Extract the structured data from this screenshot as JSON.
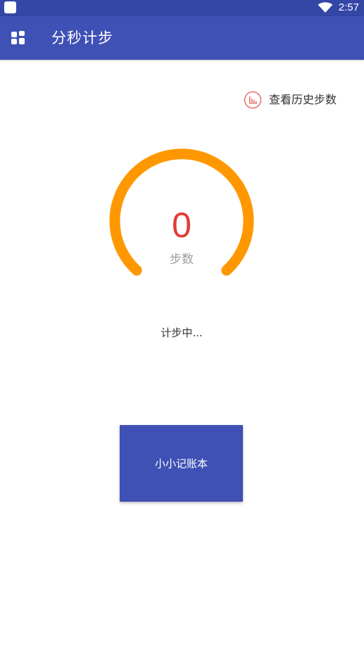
{
  "status_bar": {
    "time": "2:57",
    "icons": [
      "notification-icon",
      "wifi-icon"
    ]
  },
  "app_bar": {
    "title": "分秒计步",
    "menu_icon": "grid-menu-icon"
  },
  "history": {
    "label": "查看历史步数",
    "icon": "bar-chart-icon"
  },
  "gauge": {
    "steps": "0",
    "unit_label": "步数",
    "progress": 0,
    "arc_color": "#ff9800",
    "value_color": "#e53935"
  },
  "status": {
    "text": "计步中..."
  },
  "ledger_button": {
    "label": "小小记账本"
  },
  "colors": {
    "primary": "#3f51b5",
    "status_bar": "#3446a6",
    "accent": "#ff9800"
  }
}
